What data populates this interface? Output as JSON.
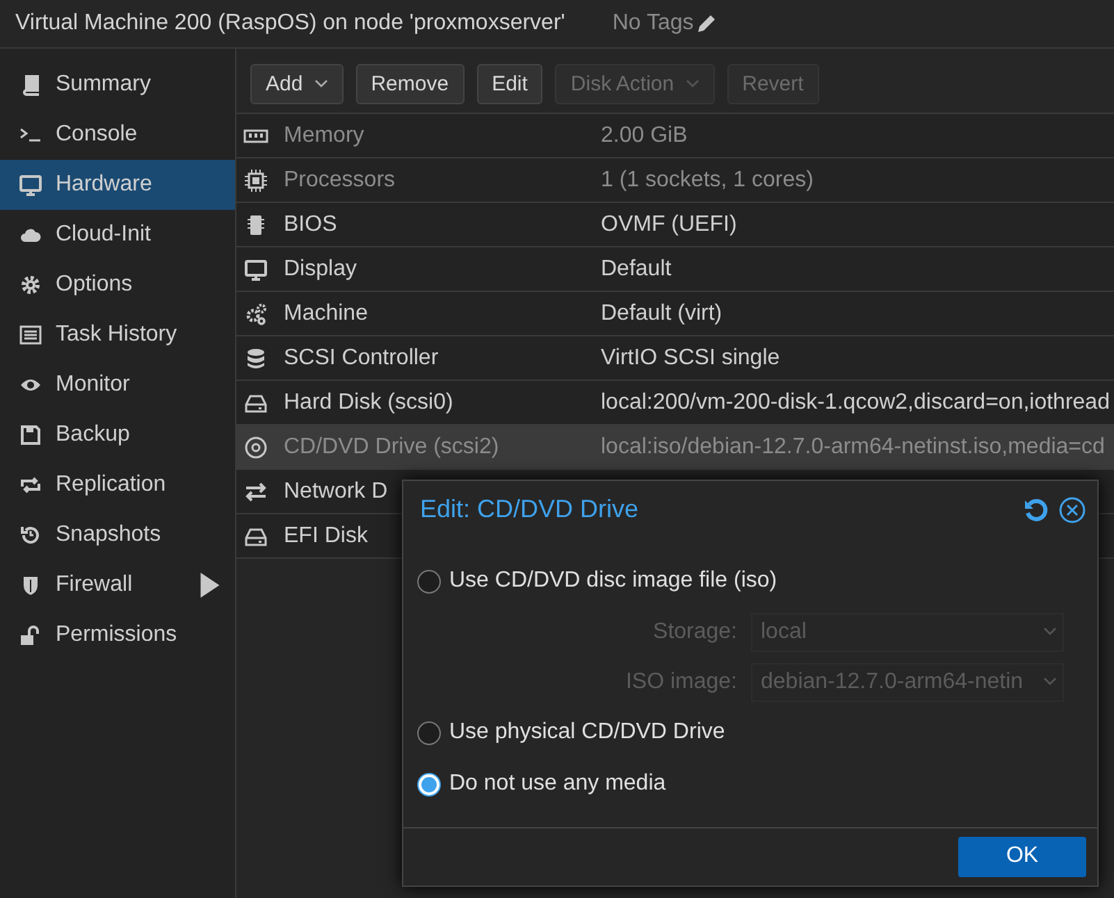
{
  "header": {
    "title": "Virtual Machine 200 (RaspOS) on node 'proxmoxserver'",
    "tags": "No Tags"
  },
  "sidebar": {
    "items": [
      {
        "label": "Summary",
        "selected": false
      },
      {
        "label": "Console",
        "selected": false
      },
      {
        "label": "Hardware",
        "selected": true
      },
      {
        "label": "Cloud-Init",
        "selected": false
      },
      {
        "label": "Options",
        "selected": false
      },
      {
        "label": "Task History",
        "selected": false
      },
      {
        "label": "Monitor",
        "selected": false
      },
      {
        "label": "Backup",
        "selected": false
      },
      {
        "label": "Replication",
        "selected": false
      },
      {
        "label": "Snapshots",
        "selected": false
      },
      {
        "label": "Firewall",
        "selected": false,
        "expandable": true
      },
      {
        "label": "Permissions",
        "selected": false
      }
    ]
  },
  "toolbar": [
    {
      "label": "Add",
      "disabled": false,
      "dropdown": true
    },
    {
      "label": "Remove",
      "disabled": false,
      "dropdown": false
    },
    {
      "label": "Edit",
      "disabled": false,
      "dropdown": false
    },
    {
      "label": "Disk Action",
      "disabled": true,
      "dropdown": true
    },
    {
      "label": "Revert",
      "disabled": true,
      "dropdown": false
    }
  ],
  "hardware": {
    "rows": [
      {
        "name": "Memory",
        "value": "2.00 GiB",
        "dimmed": true,
        "selected": false
      },
      {
        "name": "Processors",
        "value": "1 (1 sockets, 1 cores)",
        "dimmed": true,
        "selected": false
      },
      {
        "name": "BIOS",
        "value": "OVMF (UEFI)",
        "dimmed": false,
        "selected": false
      },
      {
        "name": "Display",
        "value": "Default",
        "dimmed": false,
        "selected": false
      },
      {
        "name": "Machine",
        "value": "Default (virt)",
        "dimmed": false,
        "selected": false
      },
      {
        "name": "SCSI Controller",
        "value": "VirtIO SCSI single",
        "dimmed": false,
        "selected": false
      },
      {
        "name": "Hard Disk (scsi0)",
        "value": "local:200/vm-200-disk-1.qcow2,discard=on,iothread",
        "dimmed": false,
        "selected": false
      },
      {
        "name": "CD/DVD Drive (scsi2)",
        "value": "local:iso/debian-12.7.0-arm64-netinst.iso,media=cd",
        "dimmed": true,
        "selected": true
      },
      {
        "name": "Network D",
        "value": "",
        "dimmed": false,
        "selected": false
      },
      {
        "name": "EFI Disk",
        "value": "",
        "dimmed": false,
        "selected": false
      }
    ]
  },
  "dialog": {
    "title": "Edit: CD/DVD Drive",
    "options": [
      {
        "kind": "radio",
        "label": "Use CD/DVD disc image file (iso)",
        "selected": false
      },
      {
        "kind": "field",
        "label": "Storage:",
        "value": "local",
        "disabled": true
      },
      {
        "kind": "field",
        "label": "ISO image:",
        "value": "debian-12.7.0-arm64-netin",
        "disabled": true
      },
      {
        "kind": "radio",
        "label": "Use physical CD/DVD Drive",
        "selected": false
      },
      {
        "kind": "radio",
        "label": "Do not use any media",
        "selected": true
      }
    ],
    "ok_button": "OK"
  }
}
